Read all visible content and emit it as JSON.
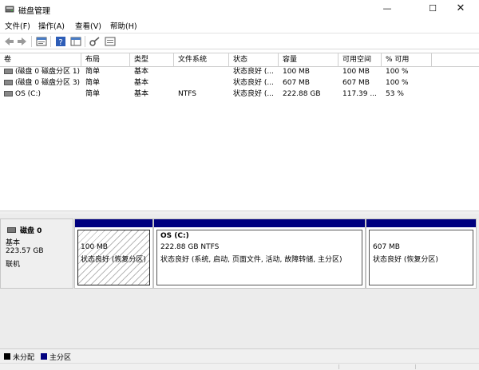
{
  "window": {
    "title": "磁盘管理",
    "minimize": "—",
    "maximize": "☐",
    "close": "✕"
  },
  "menu": [
    "文件(F)",
    "操作(A)",
    "查看(V)",
    "帮助(H)"
  ],
  "toolbar": [
    "back-icon",
    "forward-icon",
    "properties-icon",
    "help-icon",
    "grid-icon",
    "key-icon",
    "list-icon"
  ],
  "table": {
    "headers": [
      "卷",
      "布局",
      "类型",
      "文件系统",
      "状态",
      "容量",
      "可用空间",
      "% 可用"
    ],
    "rows": [
      [
        "(磁盘 0 磁盘分区 1)",
        "简单",
        "基本",
        "",
        "状态良好 (...",
        "100 MB",
        "100 MB",
        "100 %"
      ],
      [
        "(磁盘 0 磁盘分区 3)",
        "简单",
        "基本",
        "",
        "状态良好 (...",
        "607 MB",
        "607 MB",
        "100 %"
      ],
      [
        "OS (C:)",
        "简单",
        "基本",
        "NTFS",
        "状态良好 (...",
        "222.88 GB",
        "117.39 ...",
        "53 %"
      ]
    ]
  },
  "disk": {
    "name": "磁盘 0",
    "type": "基本",
    "size": "223.57 GB",
    "status": "联机",
    "partitions": [
      {
        "title": "",
        "size": "100 MB",
        "status": "状态良好 (恢复分区)"
      },
      {
        "title": "OS  (C:)",
        "size": "222.88 GB NTFS",
        "status": "状态良好 (系统, 启动, 页面文件, 活动, 故障转储, 主分区)"
      },
      {
        "title": "",
        "size": "607 MB",
        "status": "状态良好 (恢复分区)"
      }
    ]
  },
  "legend": [
    {
      "label": "未分配",
      "color": "#000000"
    },
    {
      "label": "主分区",
      "color": "#00007f"
    }
  ]
}
